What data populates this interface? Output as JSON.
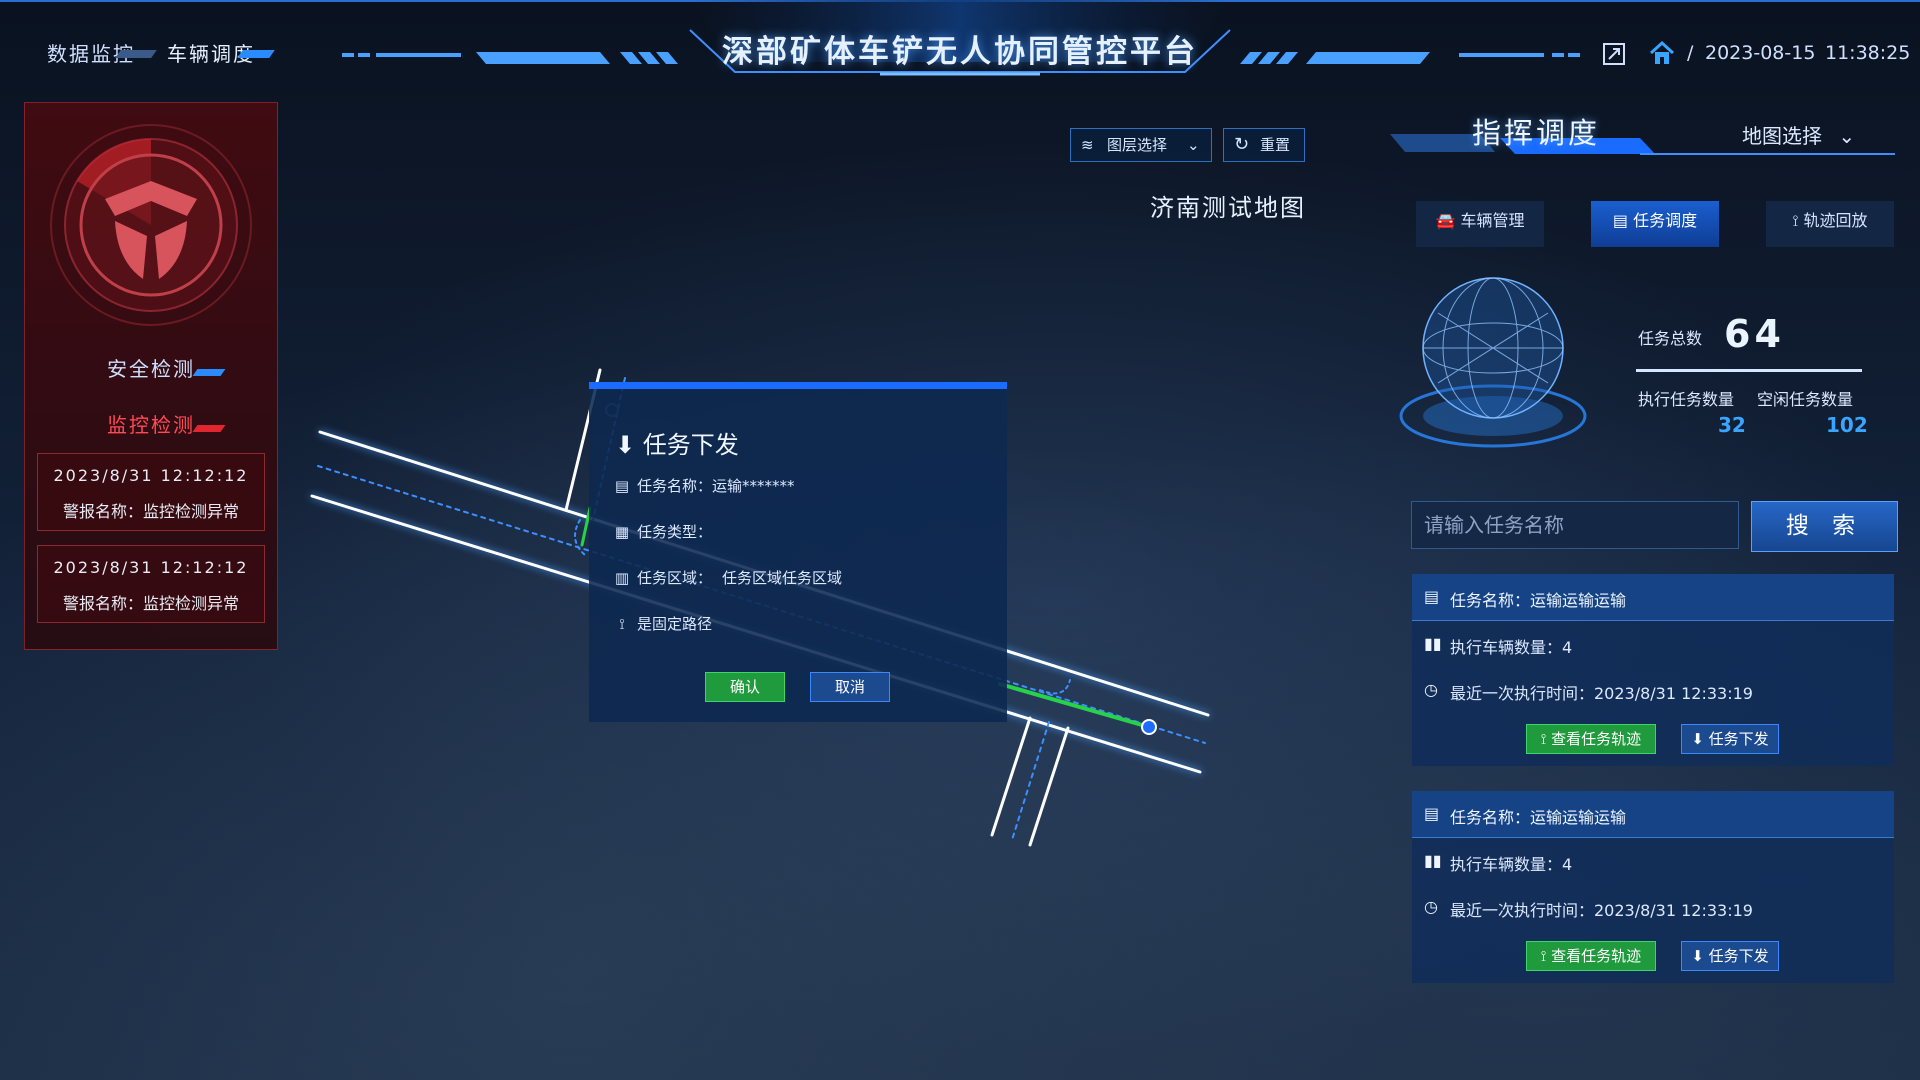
{
  "header": {
    "title": "深部矿体车铲无人协同管控平台",
    "nav": [
      "数据监控",
      "车辆调度"
    ],
    "datetime_date": "2023-08-15",
    "datetime_sep": "/",
    "datetime_time": "11:38:25"
  },
  "left": {
    "tabs": [
      "安全检测",
      "监控检测"
    ],
    "alerts": [
      {
        "time": "2023/8/31 12:12:12",
        "label": "警报名称：监控检测异常"
      },
      {
        "time": "2023/8/31 12:12:12",
        "label": "警报名称：监控检测异常"
      }
    ]
  },
  "map": {
    "layer_select": "图层选择",
    "reset": "重置",
    "map_name": "济南测试地图"
  },
  "dialog": {
    "title": "任务下发",
    "name_label": "任务名称：",
    "name_value": "运输*******",
    "type_label": "任务类型：",
    "area_label": "任务区域：",
    "area_value": "任务区域任务区域",
    "fixed_route_label": "是固定路径",
    "confirm": "确认",
    "cancel": "取消"
  },
  "right": {
    "title": "指挥调度",
    "map_select": "地图选择",
    "tabs": [
      "车辆管理",
      "任务调度",
      "轨迹回放"
    ],
    "active_tab": "任务调度",
    "stats": {
      "total_label": "任务总数",
      "total": "64",
      "exec_label": "执行任务数量",
      "exec": "32",
      "idle_label": "空闲任务数量",
      "idle": "102"
    },
    "search": {
      "placeholder": "请输入任务名称",
      "button": "搜 索"
    },
    "tasks": [
      {
        "name": "任务名称：运输运输运输",
        "vehicles": "执行车辆数量：4",
        "last_time": "最近一次执行时间：2023/8/31 12:33:19",
        "view_track": "查看任务轨迹",
        "dispatch": "任务下发"
      },
      {
        "name": "任务名称：运输运输运输",
        "vehicles": "执行车辆数量：4",
        "last_time": "最近一次执行时间：2023/8/31 12:33:19",
        "view_track": "查看任务轨迹",
        "dispatch": "任务下发"
      }
    ]
  },
  "colors": {
    "accent": "#1a6bff",
    "alert": "#e0262f",
    "ok": "#1f9a3c",
    "number": "#3aa5ff"
  }
}
